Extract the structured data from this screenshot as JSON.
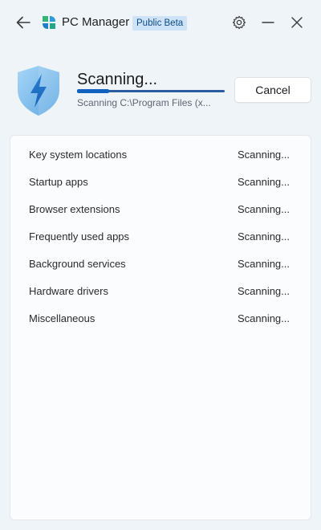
{
  "titlebar": {
    "app_title": "PC Manager",
    "badge": "Public Beta",
    "icons": [
      "back-arrow-icon",
      "pc-manager-logo",
      "gear-icon",
      "minimize-icon",
      "close-icon"
    ]
  },
  "scan": {
    "title": "Scanning...",
    "current_path": "Scanning C:\\Program Files (x...",
    "progress_fraction": 0.22,
    "cancel_label": "Cancel"
  },
  "list": {
    "items": [
      {
        "label": "Key system locations",
        "status": "Scanning..."
      },
      {
        "label": "Startup apps",
        "status": "Scanning..."
      },
      {
        "label": "Browser extensions",
        "status": "Scanning..."
      },
      {
        "label": "Frequently used apps",
        "status": "Scanning..."
      },
      {
        "label": "Background services",
        "status": "Scanning..."
      },
      {
        "label": "Hardware drivers",
        "status": "Scanning..."
      },
      {
        "label": "Miscellaneous",
        "status": "Scanning..."
      }
    ]
  },
  "colors": {
    "background": "#eff4f9",
    "accent": "#1262c1",
    "badge_bg": "#cfe3f6",
    "shield": "#8cc3ee"
  }
}
